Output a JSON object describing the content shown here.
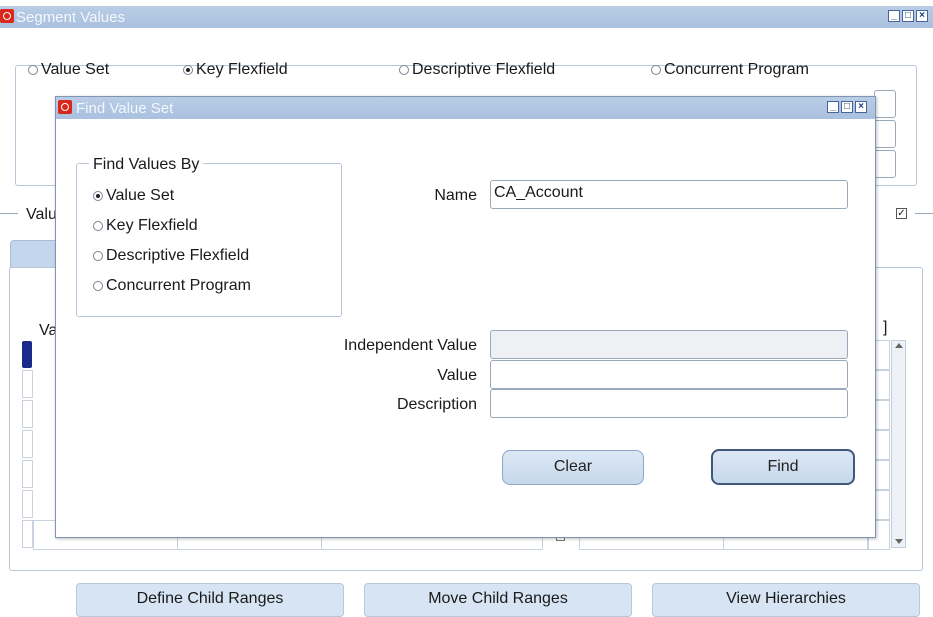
{
  "main_window": {
    "title": "Segment Values",
    "radios": [
      {
        "label": "Value Set",
        "selected": false
      },
      {
        "label": "Key Flexfield",
        "selected": true
      },
      {
        "label": "Descriptive Flexfield",
        "selected": false
      },
      {
        "label": "Concurrent Program",
        "selected": false
      }
    ],
    "values_label_partial": "Valu",
    "column_label_partial": "Va",
    "bracket_text": "]",
    "bottom_buttons": {
      "define_child_ranges": "Define Child Ranges",
      "move_child_ranges": "Move Child Ranges",
      "view_hierarchies": "View Hierarchies"
    }
  },
  "dialog": {
    "title": "Find Value Set",
    "group_title": "Find Values By",
    "radios": [
      {
        "label": "Value Set",
        "selected": true
      },
      {
        "label": "Key Flexfield",
        "selected": false
      },
      {
        "label": "Descriptive Flexfield",
        "selected": false
      },
      {
        "label": "Concurrent Program",
        "selected": false
      }
    ],
    "fields": {
      "name_label": "Name",
      "name_value": "CA_Account",
      "independent_value_label": "Independent Value",
      "independent_value": "",
      "value_label": "Value",
      "value": "",
      "description_label": "Description",
      "description": ""
    },
    "buttons": {
      "clear": "Clear",
      "find": "Find"
    }
  },
  "colors": {
    "titlebar": "#b1c7e2",
    "oracle_red": "#d8271c",
    "button_face": "#cfdff0",
    "selected_row_marker": "#1a2a8a"
  }
}
